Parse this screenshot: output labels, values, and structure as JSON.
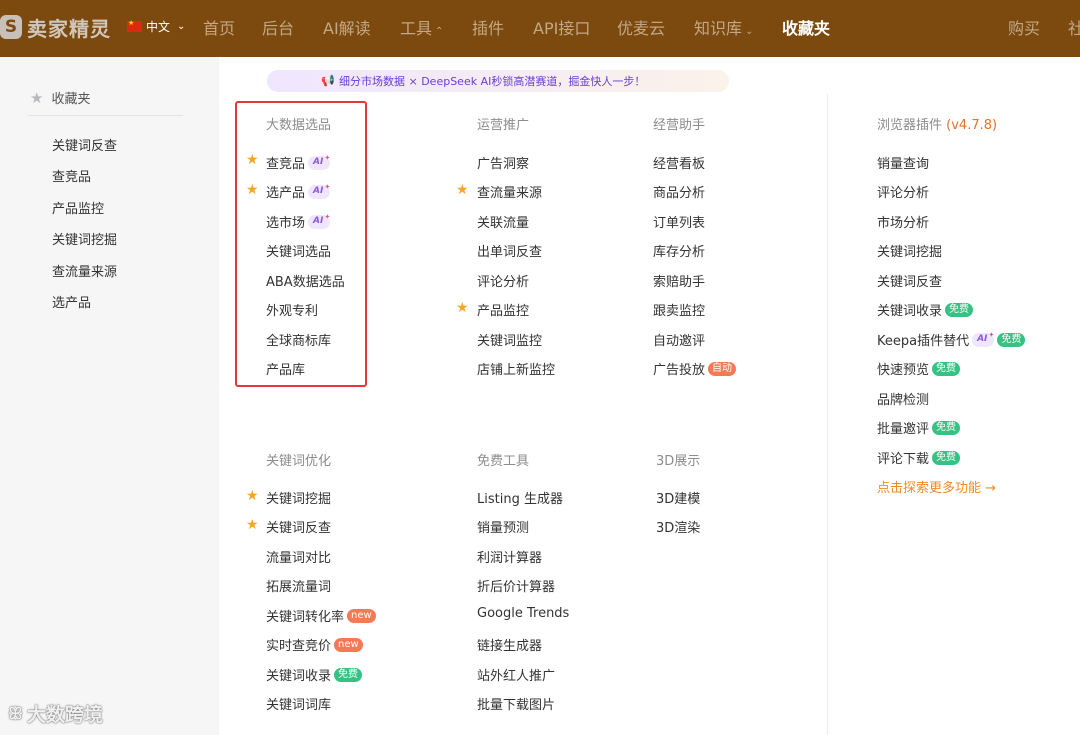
{
  "logo": {
    "mark": "S",
    "text": "卖家精灵"
  },
  "nav": {
    "lang": "中文",
    "items": [
      {
        "label": "首页"
      },
      {
        "label": "后台"
      },
      {
        "label": "AI解读"
      },
      {
        "label": "工具"
      },
      {
        "label": "插件"
      },
      {
        "label": "API接口"
      },
      {
        "label": "优麦云"
      },
      {
        "label": "知识库"
      },
      {
        "label": "收藏夹"
      },
      {
        "label": "购买"
      },
      {
        "label": "社"
      }
    ]
  },
  "sidebar": {
    "title": "收藏夹",
    "links": [
      "关键词反查",
      "查竞品",
      "产品监控",
      "关键词挖掘",
      "查流量来源",
      "选产品"
    ]
  },
  "banner": {
    "text": "细分市场数据 × DeepSeek AI秒锁高潜赛道，掘金快人一步！"
  },
  "tags": {
    "ai": "AI",
    "free": "免费",
    "new": "new",
    "auto": "自动"
  },
  "sections": {
    "bigdata": {
      "title": "大数据选品",
      "items": [
        "查竞品",
        "选产品",
        "选市场",
        "关键词选品",
        "ABA数据选品",
        "外观专利",
        "全球商标库",
        "产品库"
      ]
    },
    "ops": {
      "title": "运营推广",
      "items": [
        "广告洞察",
        "查流量来源",
        "关联流量",
        "出单词反查",
        "评论分析",
        "产品监控",
        "关键词监控",
        "店铺上新监控"
      ]
    },
    "assistant": {
      "title": "经营助手",
      "items": [
        "经营看板",
        "商品分析",
        "订单列表",
        "库存分析",
        "索赔助手",
        "跟卖监控",
        "自动邀评",
        "广告投放"
      ]
    },
    "plugin": {
      "title": "浏览器插件",
      "version": "(v4.7.8)",
      "items": [
        "销量查询",
        "评论分析",
        "市场分析",
        "关键词挖掘",
        "关键词反查",
        "关键词收录",
        "Keepa插件替代",
        "快速预览",
        "品牌检测",
        "批量邀评",
        "评论下载"
      ],
      "more": "点击探索更多功能 →"
    },
    "keyword": {
      "title": "关键词优化",
      "items": [
        "关键词挖掘",
        "关键词反查",
        "流量词对比",
        "拓展流量词",
        "关键词转化率",
        "实时查竞价",
        "关键词收录",
        "关键词词库"
      ]
    },
    "free": {
      "title": "免费工具",
      "items": [
        "Listing 生成器",
        "销量预测",
        "利润计算器",
        "折后价计算器",
        "Google Trends",
        "链接生成器",
        "站外红人推广",
        "批量下载图片"
      ]
    },
    "show3d": {
      "title": "3D展示",
      "items": [
        "3D建模",
        "3D渲染"
      ]
    }
  },
  "watermark": {
    "text": "大数跨境"
  }
}
